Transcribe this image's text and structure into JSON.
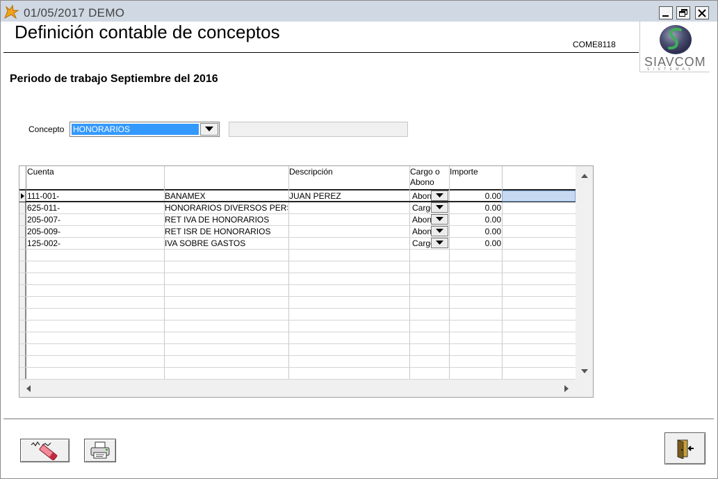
{
  "window": {
    "title": "01/05/2017  DEMO",
    "minimize_icon": "minimize-icon",
    "restore_icon": "restore-icon",
    "close_icon": "close-icon"
  },
  "header": {
    "heading": "Definición contable de conceptos",
    "code": "COME8118",
    "logo_text": "SIAVCOM",
    "logo_subtext": "S I S T E M A S"
  },
  "periodo": "Periodo de trabajo Septiembre del 2016",
  "concepto": {
    "label": "Concepto",
    "selected": "HONORARIOS",
    "description": ""
  },
  "grid": {
    "columns": [
      "Cuenta",
      "",
      "Descripción",
      "Cargo o Abono",
      "Importe"
    ],
    "header_cargo_line1": "Cargo o",
    "header_cargo_line2": "Abono",
    "rows": [
      {
        "cuenta": "111-001-",
        "nombre": "BANAMEX",
        "descripcion": "JUAN PEREZ",
        "cargo_abono": "Abono",
        "importe": "0.00"
      },
      {
        "cuenta": "625-011-",
        "nombre": "HONORARIOS DIVERSOS PERSONAS",
        "descripcion": "",
        "cargo_abono": "Cargo",
        "importe": "0.00"
      },
      {
        "cuenta": "205-007-",
        "nombre": "RET IVA DE HONORARIOS",
        "descripcion": "",
        "cargo_abono": "Abono",
        "importe": "0.00"
      },
      {
        "cuenta": "205-009-",
        "nombre": "RET ISR DE HONORARIOS",
        "descripcion": "",
        "cargo_abono": "Abono",
        "importe": "0.00"
      },
      {
        "cuenta": "125-002-",
        "nombre": "IVA SOBRE GASTOS",
        "descripcion": "",
        "cargo_abono": "Cargo",
        "importe": "0.00"
      }
    ]
  },
  "toolbar": {
    "clear_icon": "eraser-icon",
    "print_icon": "printer-icon",
    "exit_icon": "exit-door-icon"
  },
  "colors": {
    "titlebar": "#cfd8e3",
    "selection": "#3399ff",
    "row_highlight": "#c6d9f1"
  }
}
